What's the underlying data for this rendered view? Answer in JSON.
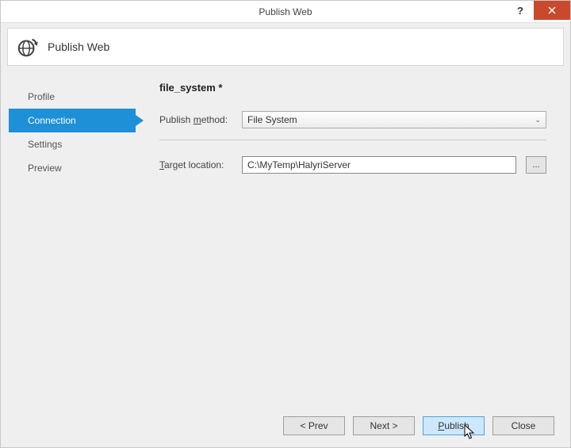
{
  "window": {
    "title": "Publish Web",
    "help": "?",
    "close": "✕"
  },
  "header": {
    "title": "Publish Web"
  },
  "sidebar": {
    "items": [
      {
        "label": "Profile",
        "active": false
      },
      {
        "label": "Connection",
        "active": true
      },
      {
        "label": "Settings",
        "active": false
      },
      {
        "label": "Preview",
        "active": false
      }
    ]
  },
  "main": {
    "profile_title": "file_system *",
    "publish_method": {
      "label_pre": "Publish ",
      "label_u": "m",
      "label_post": "ethod:",
      "value": "File System"
    },
    "target_location": {
      "label_u": "T",
      "label_post": "arget location:",
      "value": "C:\\MyTemp\\HalyriServer",
      "browse": "..."
    }
  },
  "footer": {
    "prev": "< Prev",
    "next": "Next >",
    "publish_pre": "",
    "publish_u": "P",
    "publish_post": "ublish",
    "close": "Close"
  }
}
